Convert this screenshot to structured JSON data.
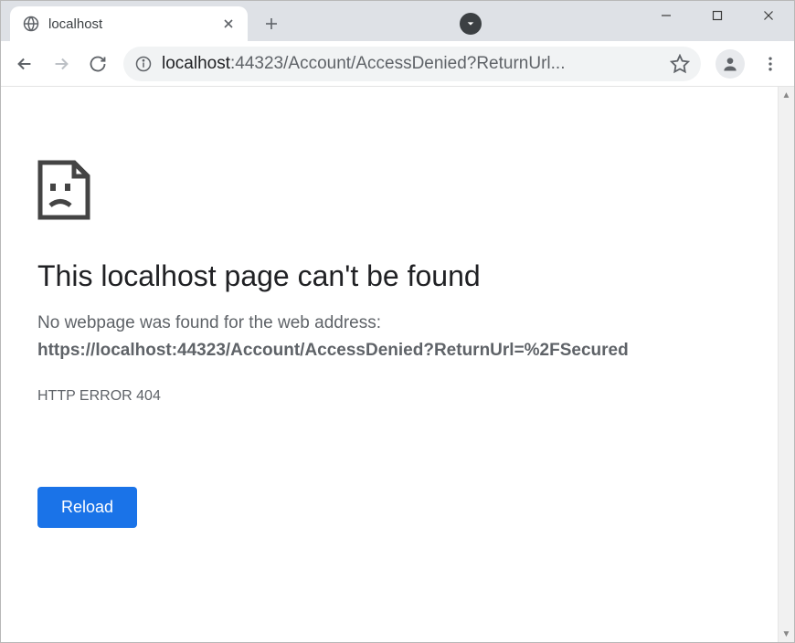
{
  "tab": {
    "title": "localhost"
  },
  "omnibox": {
    "host": "localhost",
    "path": ":44323/Account/AccessDenied?ReturnUrl..."
  },
  "error": {
    "title": "This localhost page can't be found",
    "subtitle": "No webpage was found for the web address:",
    "url": "https://localhost:44323/Account/AccessDenied?ReturnUrl=%2FSecured",
    "code": "HTTP ERROR 404",
    "reload_label": "Reload"
  }
}
